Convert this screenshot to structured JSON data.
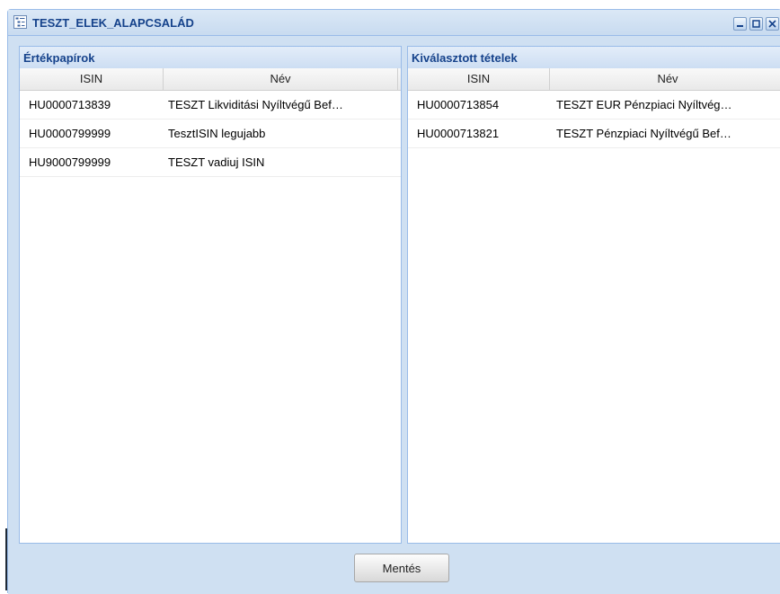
{
  "window": {
    "title": "TESZT_ELEK_ALAPCSALÁD"
  },
  "left_panel": {
    "title": "Értékpapírok",
    "columns": [
      "ISIN",
      "Név"
    ],
    "rows": [
      [
        "HU0000713839",
        "TESZT Likviditási Nyíltvégű Bef…"
      ],
      [
        "HU0000799999",
        "TesztISIN legujabb"
      ],
      [
        "HU9000799999",
        "TESZT vadiuj ISIN"
      ]
    ]
  },
  "right_panel": {
    "title": "Kiválasztott tételek",
    "columns": [
      "ISIN",
      "Név"
    ],
    "rows": [
      [
        "HU0000713854",
        "TESZT EUR Pénzpiaci Nyíltvég…"
      ],
      [
        "HU0000713821",
        "TESZT Pénzpiaci Nyíltvégű Bef…"
      ]
    ]
  },
  "footer": {
    "save_label": "Mentés"
  },
  "colors": {
    "title_text": "#15428b",
    "window_bg": "#cfe0f2",
    "border": "#99bbe8"
  },
  "icons": {
    "window_icon": "tree-list-icon",
    "minimize": "minimize-icon",
    "maximize": "maximize-icon",
    "close": "close-icon"
  }
}
